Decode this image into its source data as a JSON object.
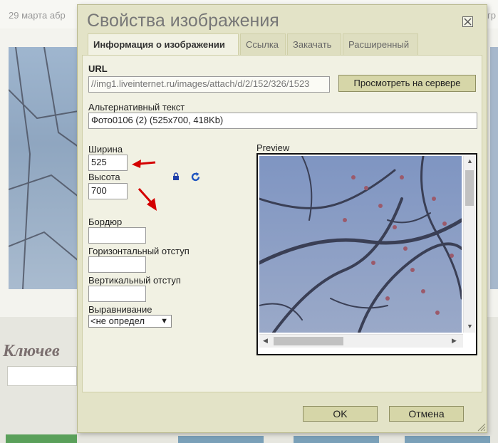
{
  "background": {
    "date_text": "29 марта абр",
    "date_right_text": "гр",
    "keywords_heading": "Ключев"
  },
  "dialog": {
    "title": "Свойства изображения",
    "tabs": [
      {
        "label": "Информация о изображении",
        "active": true
      },
      {
        "label": "Ссылка",
        "active": false
      },
      {
        "label": "Закачать",
        "active": false
      },
      {
        "label": "Расширенный",
        "active": false
      }
    ],
    "url_label": "URL",
    "url_value": "//img1.liveinternet.ru/images/attach/d/2/152/326/1523",
    "browse_server_label": "Просмотреть на сервере",
    "alt_label": "Альтернативный текст",
    "alt_value": "Фото0106 (2) (525x700, 418Kb)",
    "width_label": "Ширина",
    "width_value": "525",
    "height_label": "Высота",
    "height_value": "700",
    "border_label": "Бордюр",
    "border_value": "",
    "hspace_label": "Горизонтальный отступ",
    "hspace_value": "",
    "vspace_label": "Вертикальный отступ",
    "vspace_value": "",
    "align_label": "Выравнивание",
    "align_value": "<не определ",
    "preview_label": "Preview",
    "ok_label": "OK",
    "cancel_label": "Отмена"
  },
  "icons": {
    "lock": "lock-icon",
    "reset_size": "refresh-icon",
    "close": "close-icon",
    "resize_grip": "resize-grip-icon"
  },
  "colors": {
    "dialog_bg": "#e3e3c7",
    "panel_bg": "#f1f1e3",
    "button_bg": "#d6d6a8",
    "annotation_arrow": "#d40000"
  }
}
